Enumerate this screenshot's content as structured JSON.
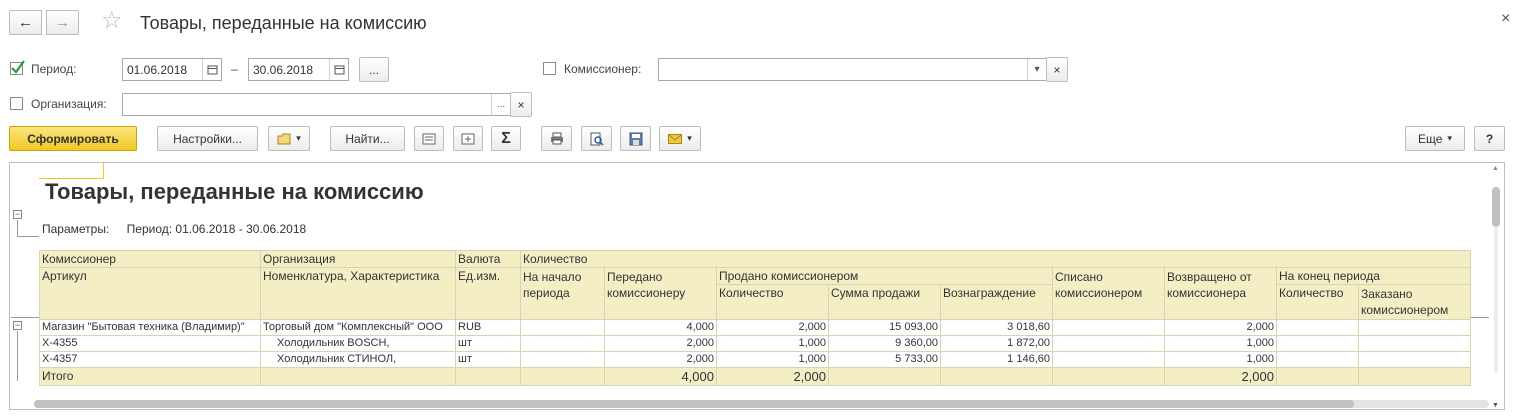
{
  "window": {
    "title": "Товары, переданные на комиссию",
    "back_icon": "←",
    "forward_icon": "→",
    "star_icon": "☆",
    "close_icon": "×"
  },
  "filters": {
    "period_label": "Период:",
    "period_checked": true,
    "period_from": "01.06.2018",
    "period_to": "30.06.2018",
    "dash": "–",
    "more": "...",
    "commissioner_label": "Комиссионер:",
    "commissioner_value": "",
    "organization_label": "Организация:",
    "organization_value": "",
    "clear_icon": "×",
    "dropdown_icon": "▾"
  },
  "toolbar": {
    "generate": "Сформировать",
    "settings": "Настройки...",
    "find": "Найти...",
    "sum_icon": "Σ",
    "more": "Еще",
    "help": "?"
  },
  "report": {
    "title": "Товары, переданные на комиссию",
    "params_label": "Параметры:",
    "params_value": "Период: 01.06.2018 - 30.06.2018",
    "header": {
      "commissioner": "Комиссионер",
      "organization": "Организация",
      "currency": "Валюта",
      "quantity": "Количество",
      "article": "Артикул",
      "nomenclature": "Номенклатура, Характеристика",
      "unit": "Ед.изм.",
      "start": "На начало периода",
      "transferred": "Передано комиссионеру",
      "sold": "Продано комиссионером",
      "written_off": "Списано комиссионером",
      "returned": "Возвращено от комиссионера",
      "end_period": "На конец периода",
      "sold_qty": "Количество",
      "sold_sum": "Сумма продажи",
      "reward": "Вознаграждение",
      "end_qty": "Количество",
      "ordered": "Заказано комиссионером"
    },
    "rows": [
      {
        "c1": "Магазин \"Бытовая техника (Владимир)\"",
        "c2": "Торговый дом \"Комплексный\" ООО",
        "c3": "RUB",
        "start": "",
        "transferred": "4,000",
        "sold_qty": "2,000",
        "sold_sum": "15 093,00",
        "reward": "3 018,60",
        "written_off": "",
        "returned": "2,000",
        "end_qty": "",
        "ordered": ""
      },
      {
        "c1": "X-4355",
        "c2": "Холодильник BOSCH,",
        "c3": "шт",
        "start": "",
        "transferred": "2,000",
        "sold_qty": "1,000",
        "sold_sum": "9 360,00",
        "reward": "1 872,00",
        "written_off": "",
        "returned": "1,000",
        "end_qty": "",
        "ordered": ""
      },
      {
        "c1": "X-4357",
        "c2": "Холодильник СТИНОЛ,",
        "c3": "шт",
        "start": "",
        "transferred": "2,000",
        "sold_qty": "1,000",
        "sold_sum": "5 733,00",
        "reward": "1 146,60",
        "written_off": "",
        "returned": "1,000",
        "end_qty": "",
        "ordered": ""
      }
    ],
    "total": {
      "label": "Итого",
      "transferred": "4,000",
      "sold_qty": "2,000",
      "returned": "2,000"
    }
  },
  "colors": {
    "accent_button": "#f0c823",
    "header_fill": "#f4eec5",
    "checkbox_check": "#2a9d3a"
  }
}
